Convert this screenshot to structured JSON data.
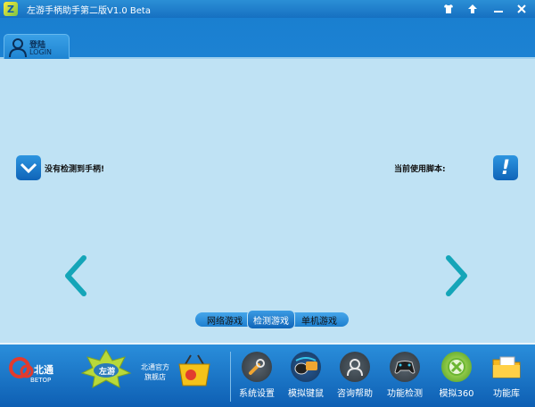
{
  "window": {
    "title": "左游手柄助手第二版V1.0 Beta",
    "icon": "app-logo-icon"
  },
  "header": {
    "login_cn": "登陆",
    "login_en": "LOGIN"
  },
  "main": {
    "status_left": "没有检测到手柄!",
    "status_right": "当前使用脚本:"
  },
  "mode_tabs": [
    {
      "label": "网络游戏"
    },
    {
      "label": "检测游戏"
    },
    {
      "label": "单机游戏"
    }
  ],
  "logos": {
    "betop_en": "BETOP",
    "betop_cn": "北通",
    "store_line1": "北通官方",
    "store_line2": "旗舰店",
    "zuoyou": "左游"
  },
  "toolbar": [
    {
      "label": "系统设置",
      "icon": "wrench-icon"
    },
    {
      "label": "模拟键鼠",
      "icon": "keyboard-mouse-icon"
    },
    {
      "label": "咨询帮助",
      "icon": "support-icon"
    },
    {
      "label": "功能检测",
      "icon": "gamepad-icon"
    },
    {
      "label": "模拟360",
      "icon": "xbox360-icon"
    },
    {
      "label": "功能库",
      "icon": "folder-icon"
    }
  ],
  "colors": {
    "title_bar": "#1670c1",
    "main_bg": "#bfe2f4",
    "arrow": "#14a5b8",
    "toolbar_bg": "#1a78c8"
  }
}
